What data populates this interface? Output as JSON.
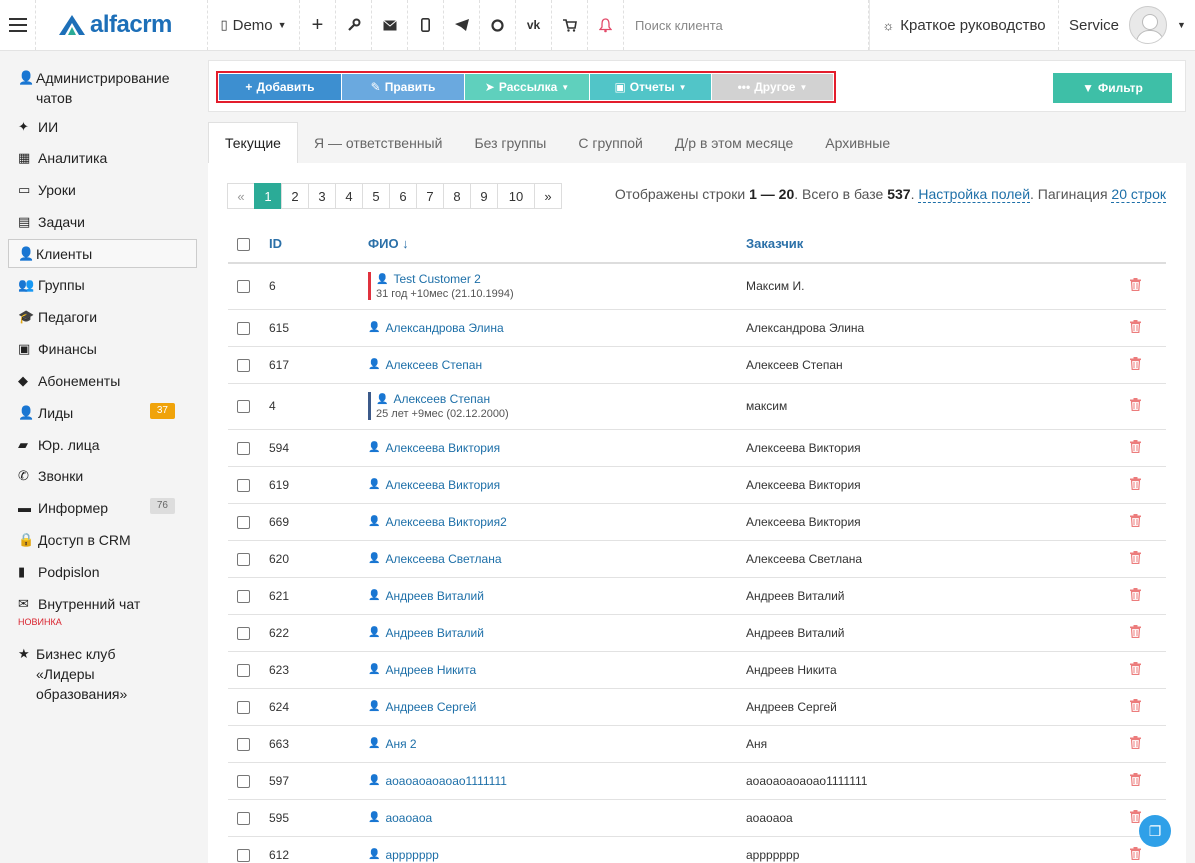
{
  "topbar": {
    "logo_text": "alfacrm",
    "demo_label": "Demo",
    "search_placeholder": "Поиск клиента",
    "guide_label": "Краткое руководство",
    "user_label": "Service"
  },
  "sidebar": {
    "items": [
      {
        "label": "Администрирование чатов",
        "icon": "user-icon"
      },
      {
        "label": "ИИ",
        "icon": "sparkle-icon"
      },
      {
        "label": "Аналитика",
        "icon": "map-icon"
      },
      {
        "label": "Уроки",
        "icon": "calendar-icon"
      },
      {
        "label": "Задачи",
        "icon": "clipboard-icon"
      },
      {
        "label": "Клиенты",
        "icon": "user-icon"
      },
      {
        "label": "Группы",
        "icon": "users-icon"
      },
      {
        "label": "Педагоги",
        "icon": "graduation-icon"
      },
      {
        "label": "Финансы",
        "icon": "money-icon"
      },
      {
        "label": "Абонементы",
        "icon": "tag-icon"
      },
      {
        "label": "Лиды",
        "icon": "user-plus-icon",
        "badge": "37"
      },
      {
        "label": "Юр. лица",
        "icon": "briefcase-icon"
      },
      {
        "label": "Звонки",
        "icon": "phone-icon"
      },
      {
        "label": "Информер",
        "icon": "inbox-icon",
        "badge": "76"
      },
      {
        "label": "Доступ в CRM",
        "icon": "lock-icon"
      },
      {
        "label": "Podpislon",
        "icon": "file-icon"
      },
      {
        "label": "Внутренний чат",
        "icon": "envelope-icon",
        "tag": "НОВИНКА"
      },
      {
        "label": "Бизнес клуб «Лидеры образования»",
        "icon": "star-icon"
      }
    ]
  },
  "toolbar": {
    "add": "Добавить",
    "edit": "Править",
    "mailing": "Рассылка",
    "reports": "Отчеты",
    "other": "Другое",
    "filter": "Фильтр",
    "colors": {
      "add": "#3d8fd0",
      "edit": "#6aa9df",
      "mailing": "#5fd0bd",
      "reports": "#51c5c8",
      "other": "#d2d2d2",
      "filter": "#3ebfa7"
    }
  },
  "tabs": [
    "Текущие",
    "Я — ответственный",
    "Без группы",
    "С группой",
    "Д/р в этом месяце",
    "Архивные"
  ],
  "pager": {
    "prev": "«",
    "pages": [
      "1",
      "2",
      "3",
      "4",
      "5",
      "6",
      "7",
      "8",
      "9",
      "10"
    ],
    "next": "»",
    "current": "1"
  },
  "pageinfo": {
    "text1": "Отображены строки",
    "range": "1 — 20",
    "text2": ". Всего в базе",
    "total": "537",
    "text3": ".",
    "fields_link": "Настройка полей",
    "text4": ". Пагинация",
    "pagination_link": "20 строк"
  },
  "table": {
    "headers": {
      "id": "ID",
      "name": "ФИО ↓",
      "customer": "Заказчик"
    },
    "rows": [
      {
        "id": "6",
        "name": "Test Customer 2",
        "sub": "31 год +10мес (21.10.1994)",
        "bar": "#e0323e",
        "customer": "Максим И."
      },
      {
        "id": "615",
        "name": "Александрова Элина",
        "customer": "Александрова Элина"
      },
      {
        "id": "617",
        "name": "Алексеев Степан",
        "customer": "Алексеев Степан"
      },
      {
        "id": "4",
        "name": "Алексеев Степан",
        "sub": "25 лет +9мес (02.12.2000)",
        "bar": "#3c5a8a",
        "customer": "максим"
      },
      {
        "id": "594",
        "name": "Алексеева Виктория",
        "customer": "Алексеева Виктория"
      },
      {
        "id": "619",
        "name": "Алексеева Виктория",
        "customer": "Алексеева Виктория"
      },
      {
        "id": "669",
        "name": "Алексеева Виктория2",
        "customer": "Алексеева Виктория"
      },
      {
        "id": "620",
        "name": "Алексеева Светлана",
        "customer": "Алексеева Светлана"
      },
      {
        "id": "621",
        "name": "Андреев Виталий",
        "customer": "Андреев Виталий"
      },
      {
        "id": "622",
        "name": "Андреев Виталий",
        "customer": "Андреев Виталий"
      },
      {
        "id": "623",
        "name": "Андреев Никита",
        "customer": "Андреев Никита"
      },
      {
        "id": "624",
        "name": "Андреев Сергей",
        "customer": "Андреев Сергей"
      },
      {
        "id": "663",
        "name": "Аня 2",
        "customer": "Аня"
      },
      {
        "id": "597",
        "name": "аоаоаоаоаоао1111111",
        "customer": "аоаоаоаоаоао1111111"
      },
      {
        "id": "595",
        "name": "аоаоаоа",
        "customer": "аоаоаоа"
      },
      {
        "id": "612",
        "name": "аррррррр",
        "customer": "аррррррр"
      }
    ]
  }
}
